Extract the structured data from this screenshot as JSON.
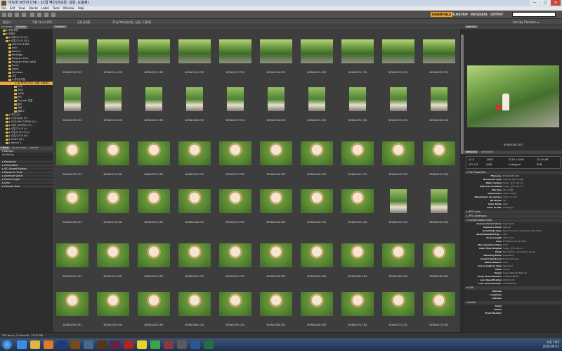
{
  "window": {
    "title": "어도비 브리지 CS6 - 21일 벡코인(보은, 남원, 도홍제)",
    "min": "—",
    "max": "□",
    "close": "✕"
  },
  "menu": [
    "File",
    "Edit",
    "View",
    "Stacks",
    "Label",
    "Tools",
    "Window",
    "Help"
  ],
  "workspaces": [
    "ESSENTIALS",
    "FILMSTRIP",
    "METADATA",
    "OUTPUT"
  ],
  "search": {
    "placeholder": "▾"
  },
  "sort_label": "Sort by Filename ▾",
  "breadcrumbs": [
    "컴퓨터",
    "로컬 디스크 (D:)",
    "공유공개정",
    "21일 벡코인(보은, 남원, 도홍제)"
  ],
  "left_tabs": {
    "favorites": "FAVORITES",
    "folders": "FOLDERS"
  },
  "folder_tree": [
    {
      "label": "▸ 바탕 화면",
      "indent": 1
    },
    {
      "label": "▾ 컴퓨터",
      "indent": 1
    },
    {
      "label": "▸ 로컬 디스크 (C:)",
      "indent": 2
    },
    {
      "label": "▾ 로컬 디스크 (D:)",
      "indent": 2
    },
    {
      "label": "$RECYCLE.BIN",
      "indent": 3
    },
    {
      "label": "Intel",
      "indent": 3
    },
    {
      "label": "Kovium",
      "indent": 3
    },
    {
      "label": "PerfLogs",
      "indent": 3
    },
    {
      "label": "Program Files",
      "indent": 3
    },
    {
      "label": "Program Files (x86)",
      "indent": 3
    },
    {
      "label": "Temp",
      "indent": 3
    },
    {
      "label": "Users",
      "indent": 3
    },
    {
      "label": "Windows",
      "indent": 3
    },
    {
      "label": "사진",
      "indent": 3
    },
    {
      "label": "▾ 공유공개정",
      "indent": 3
    },
    {
      "label": "21일 벡코인(보은, 남원, 도홍제)",
      "indent": 4,
      "selected": true
    },
    {
      "label": "CR2",
      "indent": 5
    },
    {
      "label": "JPEG",
      "indent": 5
    },
    {
      "label": "1600",
      "indent": 5
    },
    {
      "label": "JPG",
      "indent": 5
    },
    {
      "label": "Develpt 영결",
      "indent": 5
    },
    {
      "label": "출사",
      "indent": 5
    },
    {
      "label": "공유",
      "indent": 5
    },
    {
      "label": "블로그",
      "indent": 5
    },
    {
      "label": "▸ 추가 (E:)",
      "indent": 2
    },
    {
      "label": "▸ 사진(Dspl) (F:)",
      "indent": 2
    },
    {
      "label": "▸ DVD RW 드라이브 (G:)",
      "indent": 2
    },
    {
      "label": "▸ SSD_DIGITAL (H:)",
      "indent": 2
    },
    {
      "label": "▸ 로컬 디스크 (I:)",
      "indent": 2
    },
    {
      "label": "▸ 이동식 디스크 (J:)",
      "indent": 2
    },
    {
      "label": "▸ 로컬 디스크 (K:)",
      "indent": 2
    },
    {
      "label": "▸ SONY (M:)",
      "indent": 2
    },
    {
      "label": "▸ Nexus 5",
      "indent": 2
    }
  ],
  "filter_tabs": {
    "filter": "FILTER",
    "collections": "COLLECTIONS",
    "export": "EXPORT"
  },
  "filters": [
    {
      "label": "▾ Ratings",
      "head": true
    },
    {
      "label": "No Rating",
      "head": false
    },
    {
      "label": "",
      "head": false
    },
    {
      "label": "▸ Keywords",
      "head": true
    },
    {
      "label": "▸ Orientation",
      "head": true
    },
    {
      "label": "▸ ISO Speed Ratings",
      "head": true
    },
    {
      "label": "▸ Exposure Time",
      "head": true
    },
    {
      "label": "▸ Aperture Value",
      "head": true
    },
    {
      "label": "▸ Focal Length",
      "head": true
    },
    {
      "label": "▸ Lens",
      "head": true
    },
    {
      "label": "▸ Camera Raw",
      "head": true
    }
  ],
  "content_tab": "CONTENT",
  "thumbnails": [
    [
      "BORA0213.CR2",
      "BORA0214.CR2",
      "BORA0215.CR2",
      "BORA0216.CR2",
      "BORA0217.CR2",
      "BORA0218.CR2",
      "BORA0219.CR2",
      "BORA0220.CR2",
      "BORA0221.CR2",
      "BORA0222.CR2"
    ],
    [
      "BORA0223.CR2",
      "BORA0224.CR2",
      "BORA0225.CR2",
      "BORA0226.CR2",
      "BORA0227.CR2",
      "BORA0228.CR2",
      "BORA0229.CR2",
      "BORA0230.CR2",
      "BORA0231.CR2",
      "BORA0232.CR2"
    ],
    [
      "BORA0233.CR2",
      "BORA0234.CR2",
      "BORA0235.CR2",
      "BORA0236.CR2",
      "BORA0237.CR2",
      "BORA0238.CR2",
      "BORA0239.CR2",
      "BORA0240.CR2",
      "BORA0241.CR2",
      "BORA0242.CR2"
    ],
    [
      "BORA0243.CR2",
      "BORA0244.CR2",
      "BORA0245.CR2",
      "BORA0246.CR2",
      "BORA0247.CR2",
      "BORA0248.CR2",
      "BORA0249.CR2",
      "BORA0250.CR2",
      "BORA0251.CR2",
      "BORA0252.CR2"
    ],
    [
      "BORA0253.CR2",
      "BORA0254.CR2",
      "BORA0255.CR2",
      "BORA0256.CR2",
      "BORA0257.CR2",
      "BORA0258.CR2",
      "BORA0259.CR2",
      "BORA0260.CR2",
      "BORA0261.CR2",
      "BORA0262.CR2"
    ],
    [
      "BORA0263.CR2",
      "BORA0264.CR2",
      "BORA0265.CR2",
      "BORA0266.CR2",
      "BORA0267.CR2",
      "BORA0268.CR2",
      "BORA0269.CR2",
      "BORA0270.CR2",
      "BORA0271.CR2",
      "BORA0272.CR2"
    ]
  ],
  "preview_tab": "PREVIEW",
  "preview_caption": "BORA0265.CR2",
  "meta_tabs": {
    "metadata": "METADATA",
    "keywords": "KEYWORDS"
  },
  "camera_box": {
    "aperture": "ƒ/1.8",
    "shutter": "1/800",
    "dims": "3240 x 3840",
    "size": "25.19 MB",
    "iso": "ISO 100",
    "wb": "AWB",
    "mode": "Untagged",
    "color": "RGB"
  },
  "metadata_sections": [
    {
      "title": "▾ File Properties",
      "rows": [
        [
          "Filename",
          "BORA0265.CR2"
        ],
        [
          "Document Type",
          "Camera Raw image"
        ],
        [
          "Date Created",
          "Today, 오후 4:01:11"
        ],
        [
          "Date File Modified",
          "Today, 오후 4:01:12"
        ],
        [
          "File Size",
          "25.19 MB"
        ],
        [
          "Dimensions",
          "3240 x 3840"
        ],
        [
          "Dimensions (in inches)",
          "10.8\" x 12.8\""
        ],
        [
          "Bit Depth",
          "16"
        ],
        [
          "Color Mode",
          "RGB"
        ],
        [
          "Color Profile",
          "Untagged"
        ]
      ]
    },
    {
      "title": "▸ IPTC Core",
      "rows": []
    },
    {
      "title": "▸ IPTC Extension",
      "rows": []
    },
    {
      "title": "▾ Camera Data (Exif)",
      "rows": [
        [
          "Camera Owner Name",
          "Treksnetky"
        ],
        [
          "Exposure Mode",
          "Manual"
        ],
        [
          "Sensitivity Type",
          "Recommended exposure index (REI)"
        ],
        [
          "Recommended Exp...",
          "100"
        ],
        [
          "Focal Length",
          "200.0 mm"
        ],
        [
          "Lens",
          "EF200mm f/1.8L USM"
        ],
        [
          "Max Aperture Value",
          "f/1.8"
        ],
        [
          "Date Time Original",
          "Today, 오후 4:01:11"
        ],
        [
          "Flash",
          "Did not fire, compulsory mode"
        ],
        [
          "Metering Mode",
          "Evaluative"
        ],
        [
          "Custom Rendered",
          "Normal Process"
        ],
        [
          "White Balance",
          "Auto"
        ],
        [
          "Scene Capture Type",
          "Standard"
        ],
        [
          "Make",
          "Canon"
        ],
        [
          "Model",
          "Canon EOS 5D Mark III"
        ],
        [
          "Body Serial Number",
          "028021016042"
        ],
        [
          "Lens Specification",
          "200mm f/0"
        ],
        [
          "Lens Serial Number",
          "0000000000"
        ]
      ]
    },
    {
      "title": "▾ GPS",
      "rows": [
        [
          "Latitude",
          ""
        ],
        [
          "Longitude",
          ""
        ],
        [
          "Altitude",
          ""
        ]
      ]
    },
    {
      "title": "▾ Audio",
      "rows": [
        [
          "Artist",
          ""
        ],
        [
          "Album",
          ""
        ],
        [
          "Track Number",
          ""
        ]
      ]
    }
  ],
  "status_text": "319 items, 1 selected - 25.19 MB",
  "taskbar_apps": [
    {
      "name": "ie-icon",
      "color": "#3a8ee0"
    },
    {
      "name": "explorer-icon",
      "color": "#e2b443"
    },
    {
      "name": "media-icon",
      "color": "#e07a2a"
    },
    {
      "name": "photoshop-icon",
      "color": "#1f3c78"
    },
    {
      "name": "bridge-icon",
      "color": "#7a4a1c"
    },
    {
      "name": "lightroom-icon",
      "color": "#4a6788"
    },
    {
      "name": "illustrator-icon",
      "color": "#5a3416"
    },
    {
      "name": "indesign-icon",
      "color": "#6a2040"
    },
    {
      "name": "acrobat-icon",
      "color": "#b22222"
    },
    {
      "name": "kakao-icon",
      "color": "#e8d230"
    },
    {
      "name": "chrome-icon",
      "color": "#3da34a"
    },
    {
      "name": "app-icon",
      "color": "#8a3a3a"
    },
    {
      "name": "app2-icon",
      "color": "#5a5a5a"
    },
    {
      "name": "word-icon",
      "color": "#2b5797"
    },
    {
      "name": "excel-icon",
      "color": "#1e7145"
    }
  ],
  "clock": {
    "time": "오후 7:07",
    "date": "2015-05-21"
  }
}
